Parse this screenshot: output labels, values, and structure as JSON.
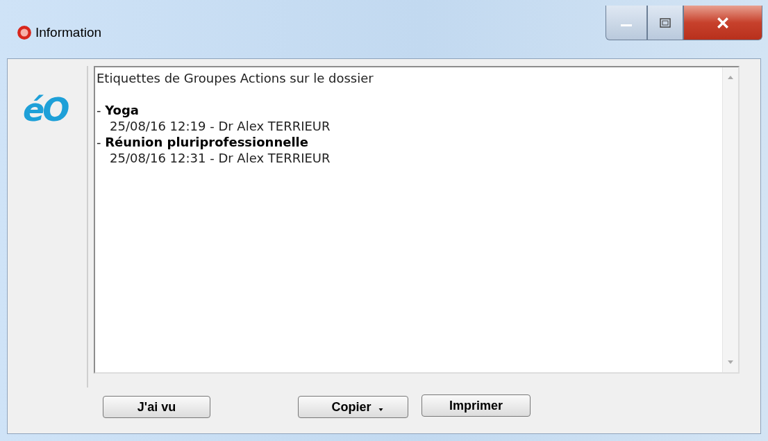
{
  "window": {
    "title": "Information"
  },
  "logo": "éO",
  "message": {
    "heading": "Etiquettes de Groupes Actions sur le dossier",
    "entries": [
      {
        "bullet": "-",
        "label": "Yoga",
        "detail": "25/08/16 12:19 - Dr Alex TERRIEUR"
      },
      {
        "bullet": "-",
        "label": "Réunion pluriprofessionnelle",
        "detail": "25/08/16 12:31 - Dr Alex TERRIEUR"
      }
    ]
  },
  "buttons": [
    {
      "label": "J'ai vu",
      "kind": "plain"
    },
    {
      "label": "Copier",
      "kind": "dropdown"
    },
    {
      "label": "Imprimer",
      "kind": "plain"
    }
  ]
}
